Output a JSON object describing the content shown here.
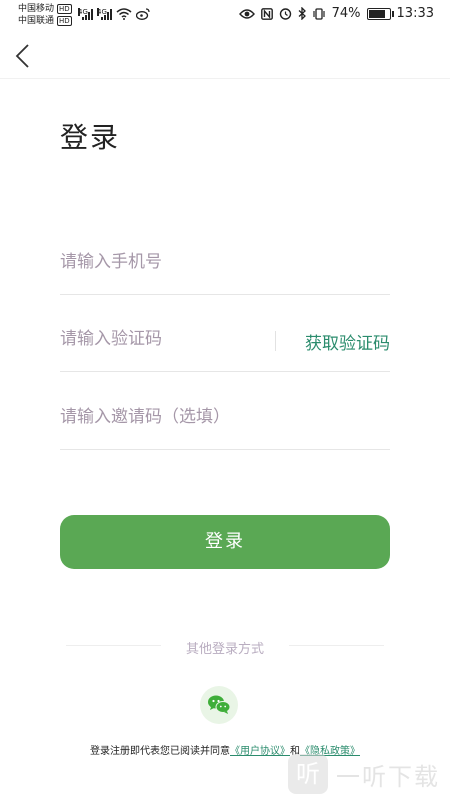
{
  "statusbar": {
    "carrier1": "中国移动",
    "carrier2": "中国联通",
    "hd": "HD",
    "net1": "4G",
    "net2": "4G",
    "battery_percent": "74%",
    "battery_level": 0.74,
    "time": "13:33"
  },
  "page": {
    "title": "登录"
  },
  "form": {
    "phone_placeholder": "请输入手机号",
    "code_placeholder": "请输入验证码",
    "get_code": "获取验证码",
    "invite_placeholder": "请输入邀请码（选填）",
    "submit": "登录"
  },
  "other_login": {
    "label": "其他登录方式"
  },
  "agreement": {
    "prefix": "登录注册即代表您已阅读并同意",
    "user_agreement": "《用户协议》",
    "and": "和",
    "privacy_policy": "《隐私政策》"
  },
  "watermark": {
    "badge": "听",
    "text": "一听下载"
  },
  "colors": {
    "primary": "#5aa854",
    "link": "#2b8c6d",
    "placeholder": "#a597a8"
  }
}
